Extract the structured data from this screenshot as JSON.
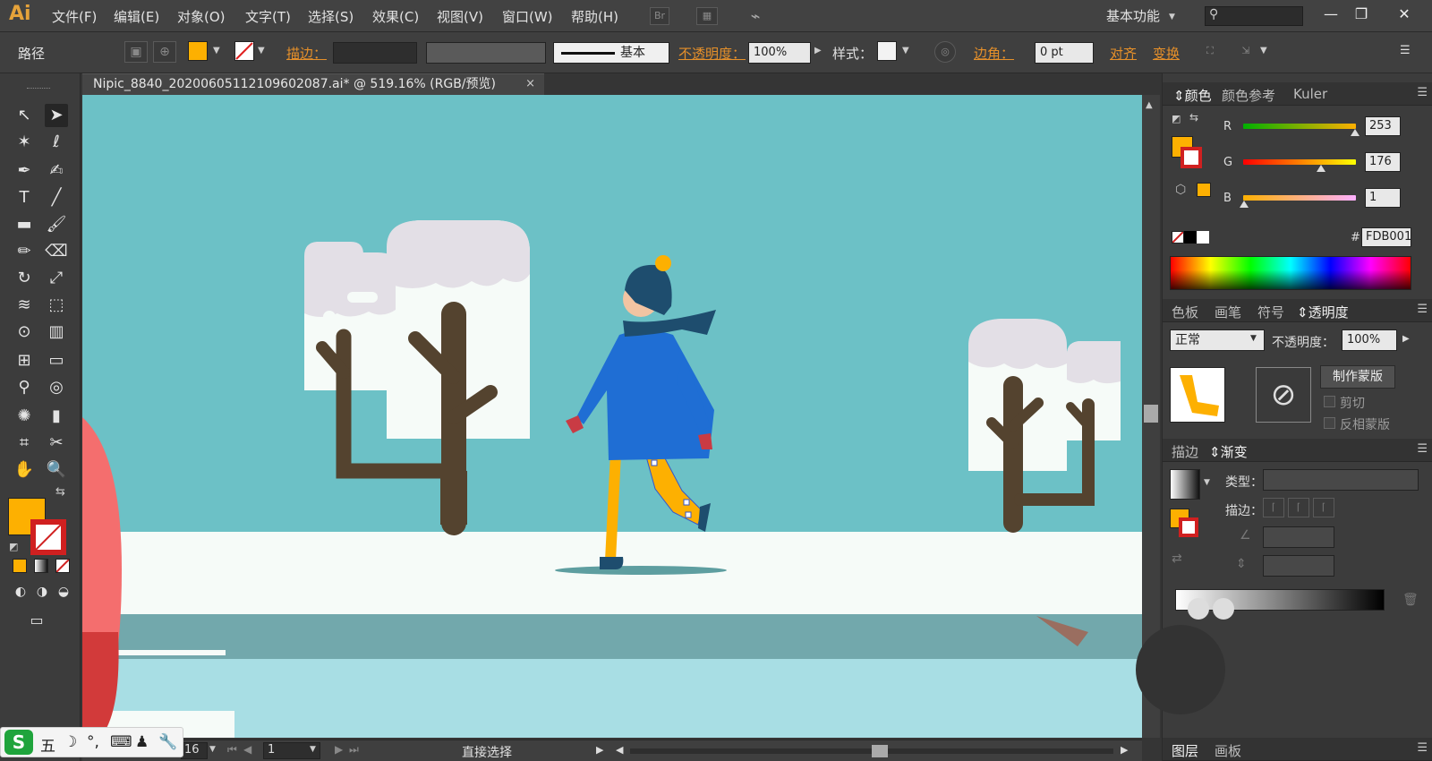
{
  "app": {
    "logo": "Ai",
    "menu": [
      "文件(F)",
      "编辑(E)",
      "对象(O)",
      "文字(T)",
      "选择(S)",
      "效果(C)",
      "视图(V)",
      "窗口(W)",
      "帮助(H)"
    ],
    "bridge_label": "Br",
    "workspace": "基本功能",
    "window_buttons": [
      "—",
      "❐",
      "✕"
    ]
  },
  "control_bar": {
    "object_type": "路径",
    "stroke_label": "描边：",
    "brush_label": "基本",
    "opacity_label": "不透明度：",
    "opacity_value": "100%",
    "style_label": "样式：",
    "corner_label": "边角：",
    "corner_value": "0 pt",
    "align_label": "对齐",
    "transform_label": "变换",
    "fill_color": "#FDB001"
  },
  "document": {
    "tab_title": "Nipic_8840_20200605112109602087.ai* @ 519.16% (RGB/预览)",
    "close": "×"
  },
  "status_bar": {
    "zoom": "16",
    "page": "1",
    "tool": "直接选择"
  },
  "ime_bar": {
    "logo": "S",
    "symbols": [
      "五",
      "☽",
      "°,",
      "⌨",
      "♟",
      "🔧"
    ]
  },
  "color_panel": {
    "tabs": [
      "颜色",
      "颜色参考",
      "Kuler"
    ],
    "channels": [
      {
        "label": "R",
        "value": "253",
        "fraction": 0.99
      },
      {
        "label": "G",
        "value": "176",
        "fraction": 0.69
      },
      {
        "label": "B",
        "value": "1",
        "fraction": 0.0
      }
    ],
    "hex_label": "#",
    "hex_value": "FDB001"
  },
  "transparency_panel": {
    "tabs": [
      "色板",
      "画笔",
      "符号",
      "透明度"
    ],
    "blend_mode": "正常",
    "opacity_label": "不透明度：",
    "opacity_value": "100%",
    "make_mask_button": "制作蒙版",
    "clip_label": "剪切",
    "invert_label": "反相蒙版"
  },
  "gradient_panel": {
    "tabs": [
      "描边",
      "渐变"
    ],
    "type_label": "类型：",
    "stroke_label": "描边："
  },
  "bottom_panel": {
    "tabs": [
      "图层",
      "画板"
    ]
  },
  "colors": {
    "accent_orange": "#FDB001",
    "sky": "#6CC1C6",
    "coat": "#1F6ED4",
    "trunk": "#54432F"
  }
}
